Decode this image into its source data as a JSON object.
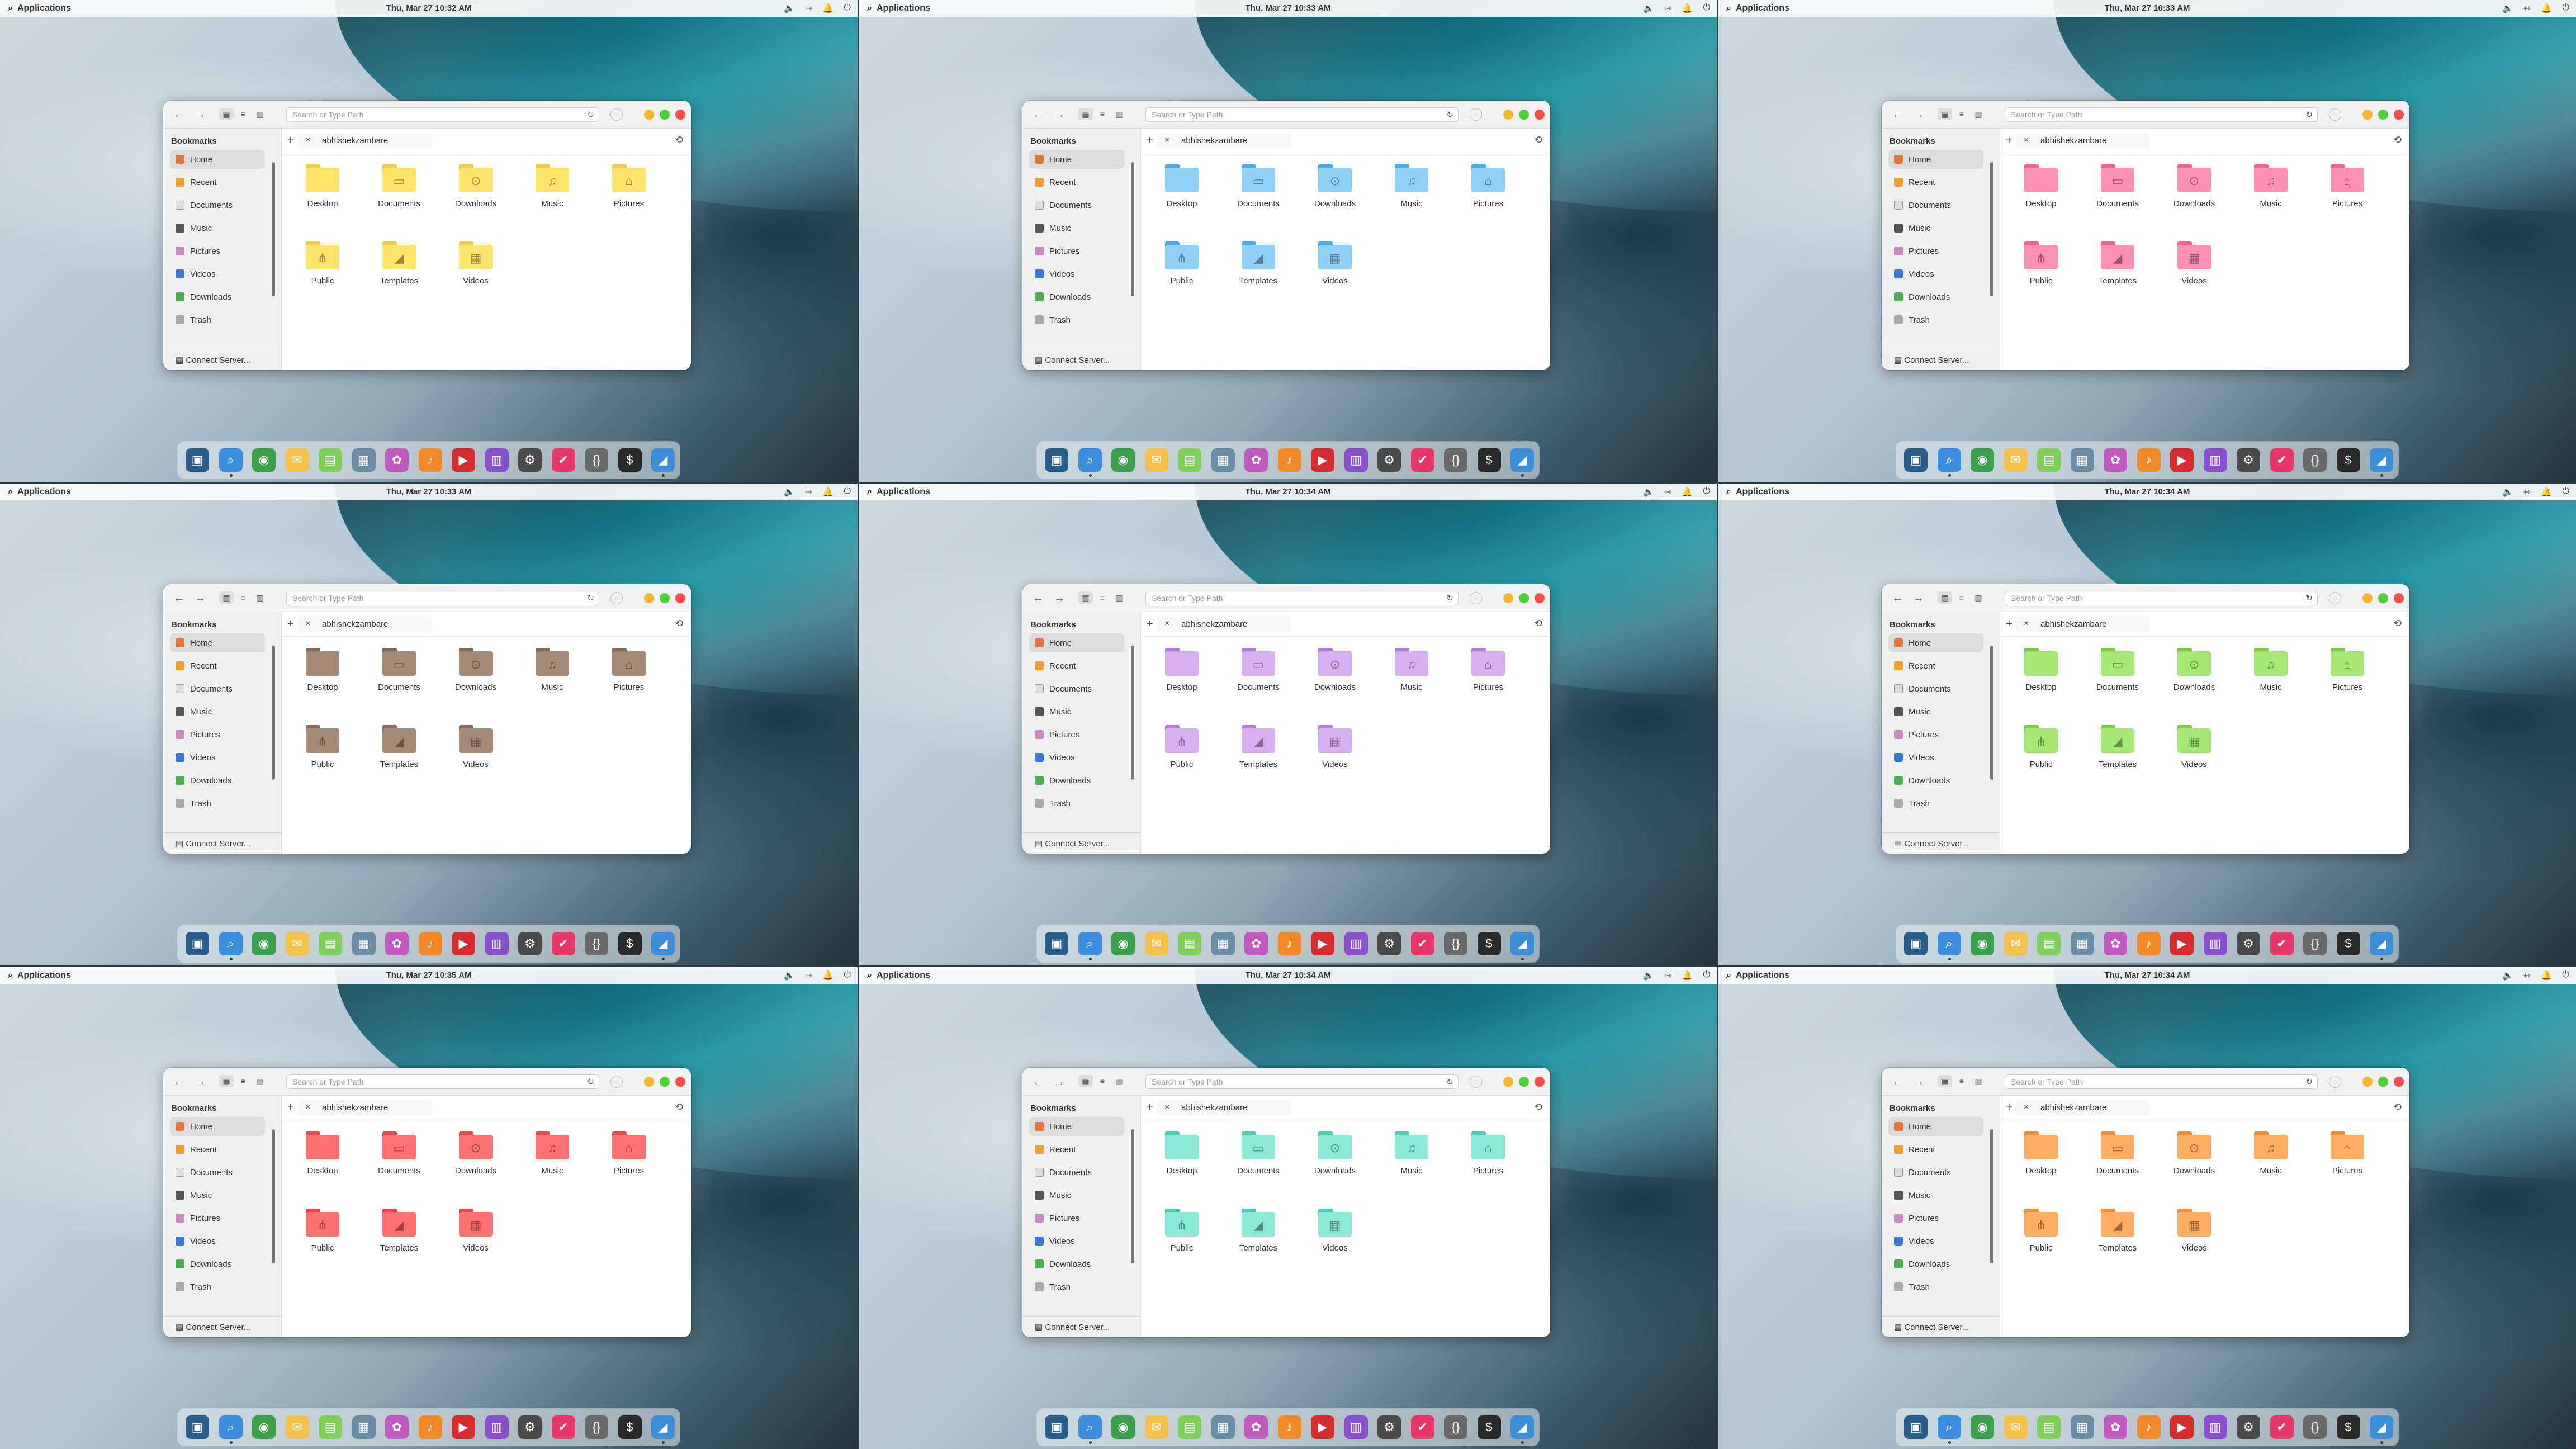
{
  "topbar": {
    "apps_label": "Applications",
    "search_icon": "search-icon",
    "indicators": [
      "volume-icon",
      "network-icon",
      "notifications-icon",
      "power-icon"
    ]
  },
  "clocks": [
    "Thu, Mar 27   10:32 AM",
    "Thu, Mar 27   10:33 AM",
    "Thu, Mar 27   10:33 AM",
    "Thu, Mar 27   10:33 AM",
    "Thu, Mar 27   10:34 AM",
    "Thu, Mar 27   10:34 AM",
    "Thu, Mar 27   10:35 AM",
    "Thu, Mar 27   10:34 AM",
    "Thu, Mar 27   10:34 AM"
  ],
  "themes": [
    {
      "name": "yellow",
      "folder": "#ffe36a",
      "back": "#f2c94c"
    },
    {
      "name": "blue",
      "folder": "#8fd0f7",
      "back": "#4aa9e8"
    },
    {
      "name": "pink",
      "folder": "#ff8fb5",
      "back": "#f0608f"
    },
    {
      "name": "brown",
      "folder": "#a58a78",
      "back": "#856a58"
    },
    {
      "name": "purple",
      "folder": "#d8b0f0",
      "back": "#b27dd8"
    },
    {
      "name": "green",
      "folder": "#a5e873",
      "back": "#7cc947"
    },
    {
      "name": "red",
      "folder": "#ff7070",
      "back": "#e24a4a"
    },
    {
      "name": "teal",
      "folder": "#8ce8d6",
      "back": "#4ccbb2"
    },
    {
      "name": "orange",
      "folder": "#ffad62",
      "back": "#f48a35"
    }
  ],
  "window": {
    "search_placeholder": "Search or Type Path",
    "tab_label": "abhishekzambare",
    "bookmarks_heading": "Bookmarks",
    "connect_label": "Connect Server...",
    "sidebar": [
      {
        "label": "Home",
        "icon": "home-icon",
        "color": "#e2763a"
      },
      {
        "label": "Recent",
        "icon": "recent-icon",
        "color": "#f0a030"
      },
      {
        "label": "Documents",
        "icon": "documents-icon",
        "color": "#dddddd"
      },
      {
        "label": "Music",
        "icon": "music-icon",
        "color": "#555555"
      },
      {
        "label": "Pictures",
        "icon": "pictures-icon",
        "color": "#c98bbd"
      },
      {
        "label": "Videos",
        "icon": "videos-icon",
        "color": "#3a7bd5"
      },
      {
        "label": "Downloads",
        "icon": "downloads-icon",
        "color": "#4cb050"
      },
      {
        "label": "Trash",
        "icon": "trash-icon",
        "color": "#aaaaaa"
      }
    ],
    "folders": [
      {
        "label": "Desktop",
        "glyph": ""
      },
      {
        "label": "Documents",
        "glyph": "▭"
      },
      {
        "label": "Downloads",
        "glyph": "⊙"
      },
      {
        "label": "Music",
        "glyph": "♫"
      },
      {
        "label": "Pictures",
        "glyph": "⌂"
      },
      {
        "label": "Public",
        "glyph": "⋔"
      },
      {
        "label": "Templates",
        "glyph": "◢"
      },
      {
        "label": "Videos",
        "glyph": "▦"
      }
    ]
  },
  "dock": [
    {
      "name": "multitasking-view-icon",
      "color": "#2b5d8a",
      "glyph": "▣"
    },
    {
      "name": "files-search-icon",
      "color": "#3b8ee0",
      "glyph": "⌕"
    },
    {
      "name": "web-browser-icon",
      "color": "#3aa04a",
      "glyph": "◉"
    },
    {
      "name": "mail-icon",
      "color": "#f3c14a",
      "glyph": "✉"
    },
    {
      "name": "calendar-icon",
      "color": "#7fcf5a",
      "glyph": "▤"
    },
    {
      "name": "tasks-icon",
      "color": "#6a8da6",
      "glyph": "▦"
    },
    {
      "name": "photos-icon",
      "color": "#c05ac0",
      "glyph": "✿"
    },
    {
      "name": "music-player-icon",
      "color": "#f28a2a",
      "glyph": "♪"
    },
    {
      "name": "videos-player-icon",
      "color": "#d62c2c",
      "glyph": "▶"
    },
    {
      "name": "app-center-icon",
      "color": "#8a4fd0",
      "glyph": "▥"
    },
    {
      "name": "system-settings-icon",
      "color": "#4a4a4a",
      "glyph": "⚙"
    },
    {
      "name": "checklist-icon",
      "color": "#e8386a",
      "glyph": "✔"
    },
    {
      "name": "code-editor-icon",
      "color": "#6a6a6a",
      "glyph": "{}"
    },
    {
      "name": "terminal-icon",
      "color": "#2a2a2a",
      "glyph": "$"
    },
    {
      "name": "screenshot-icon",
      "color": "#3a8fd8",
      "glyph": "◢"
    }
  ]
}
